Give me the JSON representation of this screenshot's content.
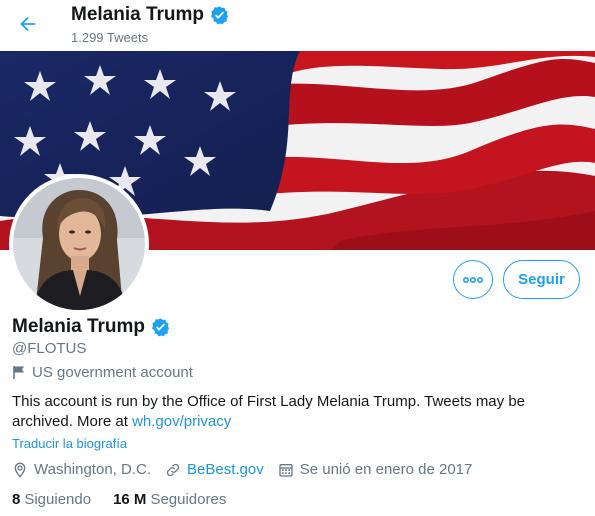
{
  "header": {
    "name": "Melania Trump",
    "tweet_count": "1.299 Tweets"
  },
  "actions": {
    "follow_label": "Seguir"
  },
  "profile": {
    "name": "Melania Trump",
    "handle": "@FLOTUS",
    "account_label": "US government account",
    "bio_text": "This account is run by the Office of First Lady Melania Trump. Tweets may be archived. More at ",
    "bio_link": "wh.gov/privacy",
    "translate_label": "Traducir la biografía",
    "location": "Washington, D.C.",
    "website": "BeBest.gov",
    "joined": "Se unió en enero de 2017",
    "following_count": "8",
    "following_label": "Siguiendo",
    "followers_count": "16 M",
    "followers_label": "Seguidores"
  },
  "colors": {
    "accent": "#1da1f2",
    "link": "#1b95e0",
    "secondary_text": "#657786"
  },
  "icons": [
    "back-arrow-icon",
    "verified-badge-icon",
    "more-icon",
    "flag-icon",
    "location-icon",
    "link-icon",
    "calendar-icon"
  ]
}
